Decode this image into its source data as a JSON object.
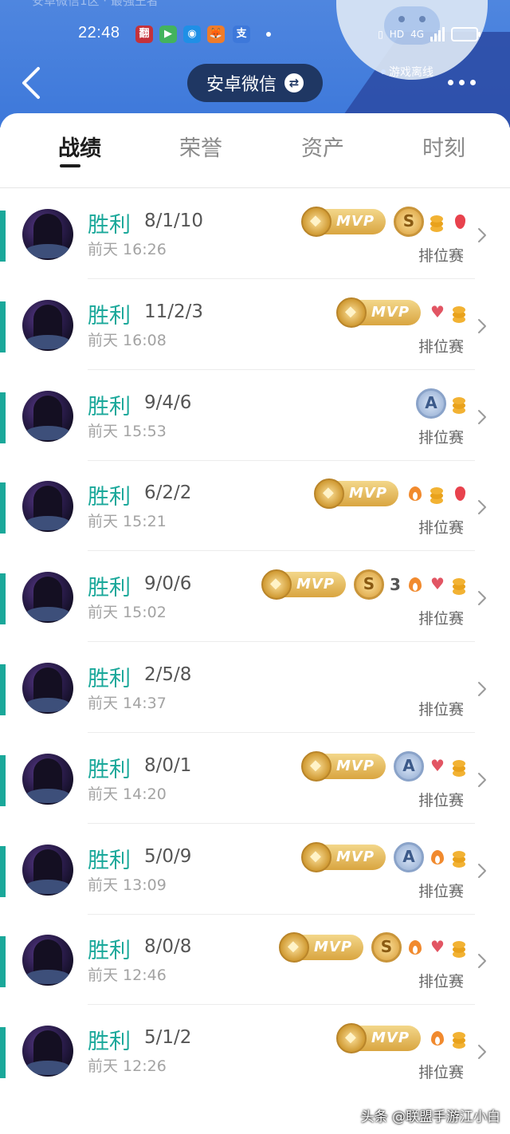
{
  "status_bar": {
    "ghost_text": "安卓微信1区 · 最强王者",
    "time": "22:48",
    "apps": [
      {
        "name": "douyin-app-icon",
        "glyph": "翻",
        "color": "#c4323b"
      },
      {
        "name": "video-app-icon",
        "glyph": "▶",
        "color": "#43b35d"
      },
      {
        "name": "camera-app-icon",
        "glyph": "◉",
        "color": "#1f8fe6"
      },
      {
        "name": "fox-app-icon",
        "glyph": "🦊",
        "color": "#ef7c2a"
      },
      {
        "name": "alipay-app-icon",
        "glyph": "支",
        "color": "#3d78da"
      }
    ],
    "hd_label": "HD",
    "net_label": "4G"
  },
  "header": {
    "account_label": "安卓微信",
    "status_text": "游戏离线"
  },
  "tabs": [
    {
      "label": "战绩",
      "active": true
    },
    {
      "label": "荣誉",
      "active": false
    },
    {
      "label": "资产",
      "active": false
    },
    {
      "label": "时刻",
      "active": false
    }
  ],
  "matches": [
    {
      "result": "胜利",
      "kda": "8/1/10",
      "time": "前天 16:26",
      "mode": "排位赛",
      "badges": [
        "mvp",
        "grade-s",
        "coins",
        "drop"
      ]
    },
    {
      "result": "胜利",
      "kda": "11/2/3",
      "time": "前天 16:08",
      "mode": "排位赛",
      "badges": [
        "mvp",
        "lotus",
        "coins"
      ]
    },
    {
      "result": "胜利",
      "kda": "9/4/6",
      "time": "前天 15:53",
      "mode": "排位赛",
      "badges": [
        "grade-a",
        "coins"
      ]
    },
    {
      "result": "胜利",
      "kda": "6/2/2",
      "time": "前天 15:21",
      "mode": "排位赛",
      "badges": [
        "mvp",
        "fire",
        "coins",
        "drop"
      ]
    },
    {
      "result": "胜利",
      "kda": "9/0/6",
      "time": "前天 15:02",
      "mode": "排位赛",
      "badges": [
        "mvp",
        "grade-s",
        "streak-3",
        "fire",
        "lotus",
        "coins"
      ]
    },
    {
      "result": "胜利",
      "kda": "2/5/8",
      "time": "前天 14:37",
      "mode": "排位赛",
      "badges": []
    },
    {
      "result": "胜利",
      "kda": "8/0/1",
      "time": "前天 14:20",
      "mode": "排位赛",
      "badges": [
        "mvp",
        "grade-a",
        "lotus",
        "coins"
      ]
    },
    {
      "result": "胜利",
      "kda": "5/0/9",
      "time": "前天 13:09",
      "mode": "排位赛",
      "badges": [
        "mvp",
        "grade-a",
        "fire",
        "coins"
      ]
    },
    {
      "result": "胜利",
      "kda": "8/0/8",
      "time": "前天 12:46",
      "mode": "排位赛",
      "badges": [
        "mvp",
        "grade-s",
        "fire",
        "lotus",
        "coins"
      ]
    },
    {
      "result": "胜利",
      "kda": "5/1/2",
      "time": "前天 12:26",
      "mode": "排位赛",
      "badges": [
        "mvp",
        "fire",
        "coins"
      ]
    }
  ],
  "badge_text": {
    "mvp": "MVP",
    "grade_s": "S",
    "grade_a": "A",
    "streak": "3"
  },
  "colors": {
    "header_blue": "#3d78da",
    "win_teal": "#1aa89a",
    "mvp_gold": "#d9a540"
  },
  "watermark": "头条 @联盟手游江小白"
}
